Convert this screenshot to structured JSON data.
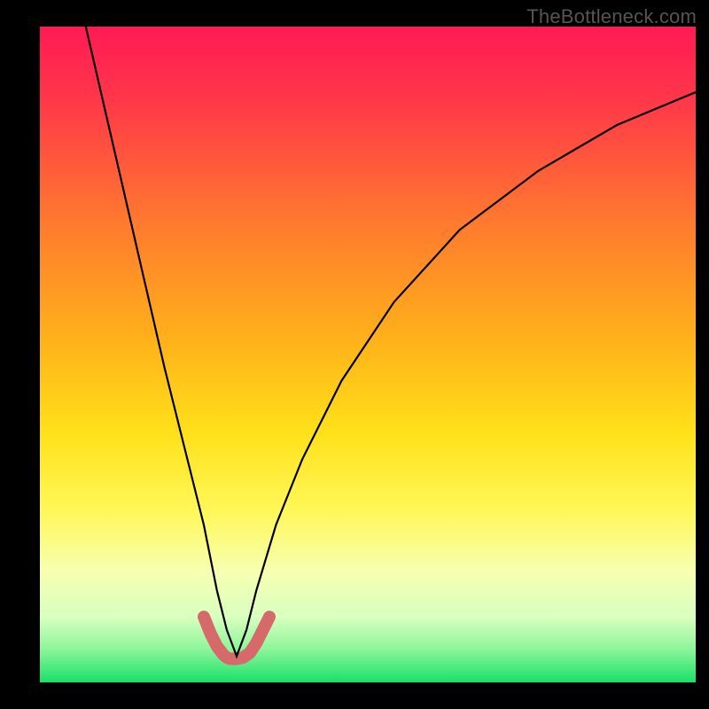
{
  "watermark": "TheBottleneck.com",
  "chart_data": {
    "type": "line",
    "title": "",
    "xlabel": "",
    "ylabel": "",
    "xlim": [
      0,
      100
    ],
    "ylim": [
      0,
      100
    ],
    "grid": false,
    "legend": false,
    "annotations": [],
    "series": [
      {
        "name": "bottleneck-curve",
        "x": [
          7,
          10,
          13,
          16,
          19,
          22,
          25,
          27,
          28.5,
          30,
          31.5,
          33,
          36,
          40,
          46,
          54,
          64,
          76,
          88,
          100
        ],
        "values": [
          100,
          87,
          74,
          61,
          48,
          36,
          24,
          14,
          8,
          4,
          8,
          14,
          24,
          34,
          46,
          58,
          69,
          78,
          85,
          90
        ]
      },
      {
        "name": "minimum-marker",
        "x": [
          25,
          26,
          27,
          28,
          28.5,
          29,
          30,
          31,
          32,
          33,
          34,
          35
        ],
        "values": [
          10,
          7.5,
          5.5,
          4.2,
          3.8,
          3.6,
          3.6,
          3.8,
          4.5,
          6,
          8,
          10
        ]
      }
    ],
    "gradient_stops": [
      {
        "offset": 0.0,
        "color": "#ff1a55"
      },
      {
        "offset": 0.12,
        "color": "#ff3a48"
      },
      {
        "offset": 0.3,
        "color": "#ff7a2e"
      },
      {
        "offset": 0.48,
        "color": "#ffb21a"
      },
      {
        "offset": 0.62,
        "color": "#ffe11a"
      },
      {
        "offset": 0.74,
        "color": "#fff85a"
      },
      {
        "offset": 0.83,
        "color": "#f7ffb0"
      },
      {
        "offset": 0.9,
        "color": "#d9ffc0"
      },
      {
        "offset": 0.95,
        "color": "#8cf59a"
      },
      {
        "offset": 1.0,
        "color": "#18e06a"
      }
    ],
    "styles": {
      "curve": {
        "stroke": "#000000",
        "width": 2.2
      },
      "marker": {
        "stroke": "#d66a6a",
        "width": 14,
        "linecap": "round",
        "linejoin": "round"
      }
    }
  }
}
